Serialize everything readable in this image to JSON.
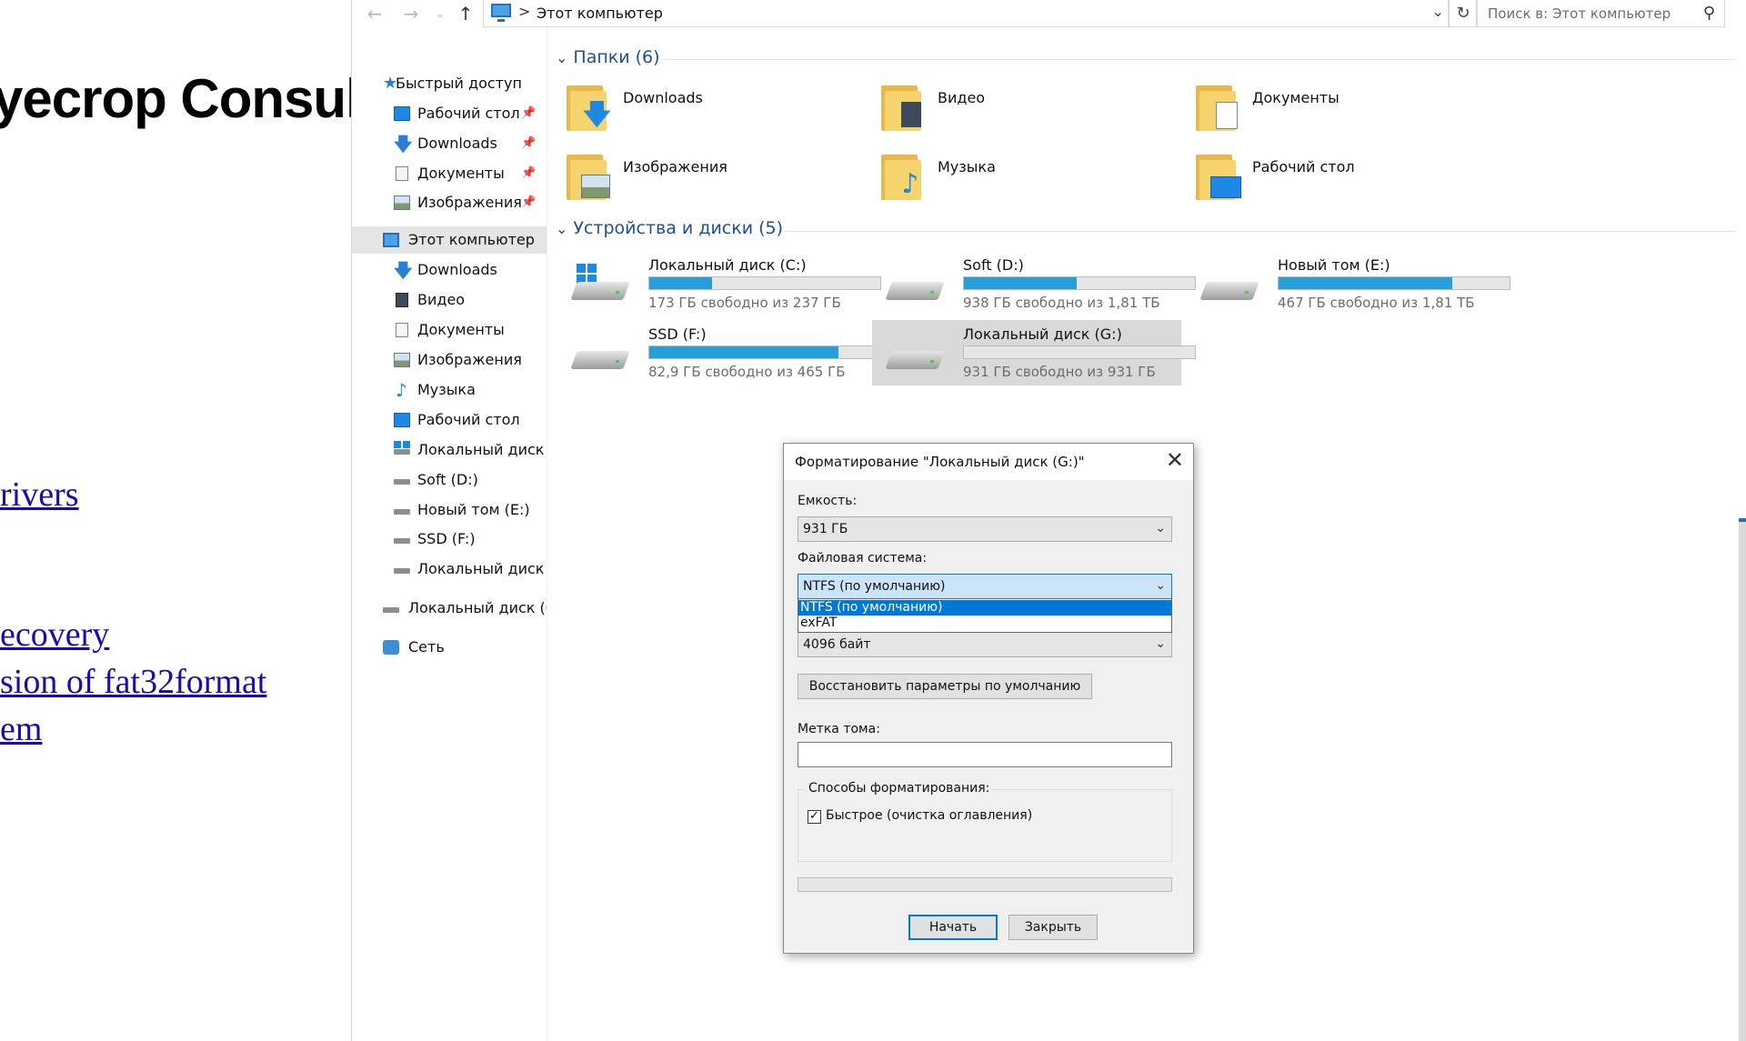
{
  "background_page": {
    "heading": "yecrop Consul",
    "links": [
      "rivers",
      "ecovery",
      "sion of fat32format",
      "em"
    ]
  },
  "explorer": {
    "address": {
      "path": "Этот компьютер",
      "separator": ">"
    },
    "search": {
      "placeholder": "Поиск в: Этот компьютер"
    },
    "nav": {
      "quick_access": "Быстрый доступ",
      "quick_items": [
        "Рабочий стол",
        "Downloads",
        "Документы",
        "Изображения"
      ],
      "this_pc": "Этот компьютер",
      "pc_items": [
        "Downloads",
        "Видео",
        "Документы",
        "Изображения",
        "Музыка",
        "Рабочий стол",
        "Локальный диск (C",
        "Soft (D:)",
        "Новый том (E:)",
        "SSD (F:)",
        "Локальный диск (G"
      ],
      "drive_g": "Локальный диск (G:)",
      "network": "Сеть"
    },
    "folders_header": "Папки (6)",
    "folders": [
      {
        "name": "Downloads",
        "icon": "arrow-down-icon"
      },
      {
        "name": "Видео",
        "icon": "film-icon"
      },
      {
        "name": "Документы",
        "icon": "document-icon"
      },
      {
        "name": "Изображения",
        "icon": "picture-icon"
      },
      {
        "name": "Музыка",
        "icon": "music-note-icon"
      },
      {
        "name": "Рабочий стол",
        "icon": "desktop-icon"
      }
    ],
    "drives_header": "Устройства и диски (5)",
    "drives": [
      {
        "name": "Локальный диск (C:)",
        "free": "173 ГБ свободно из 237 ГБ",
        "used_fraction": 0.27
      },
      {
        "name": "Soft (D:)",
        "free": "938 ГБ свободно из 1,81 ТБ",
        "used_fraction": 0.49
      },
      {
        "name": "Новый том (E:)",
        "free": "467 ГБ свободно из 1,81 ТБ",
        "used_fraction": 0.75
      },
      {
        "name": "SSD (F:)",
        "free": "82,9 ГБ свободно из 465 ГБ",
        "used_fraction": 0.82
      },
      {
        "name": "Локальный диск (G:)",
        "free": "931 ГБ свободно из 931 ГБ",
        "used_fraction": 0.0
      }
    ]
  },
  "dialog": {
    "title": "Форматирование \"Локальный диск (G:)\"",
    "capacity_label": "Емкость:",
    "capacity_value": "931 ГБ",
    "fs_label": "Файловая система:",
    "fs_value": "NTFS (по умолчанию)",
    "fs_options": [
      "NTFS (по умолчанию)",
      "exFAT"
    ],
    "cluster_value": "4096 байт",
    "restore_button": "Восстановить параметры по умолчанию",
    "volume_label": "Метка тома:",
    "volume_value": "",
    "format_options_label": "Способы форматирования:",
    "quick_format_label": "Быстрое (очистка оглавления)",
    "quick_format_checked": true,
    "start_button": "Начать",
    "close_button": "Закрыть"
  },
  "colors": {
    "accent": "#0078d7",
    "bar_fill": "#26a0da",
    "header_text": "#1e4e9b"
  }
}
